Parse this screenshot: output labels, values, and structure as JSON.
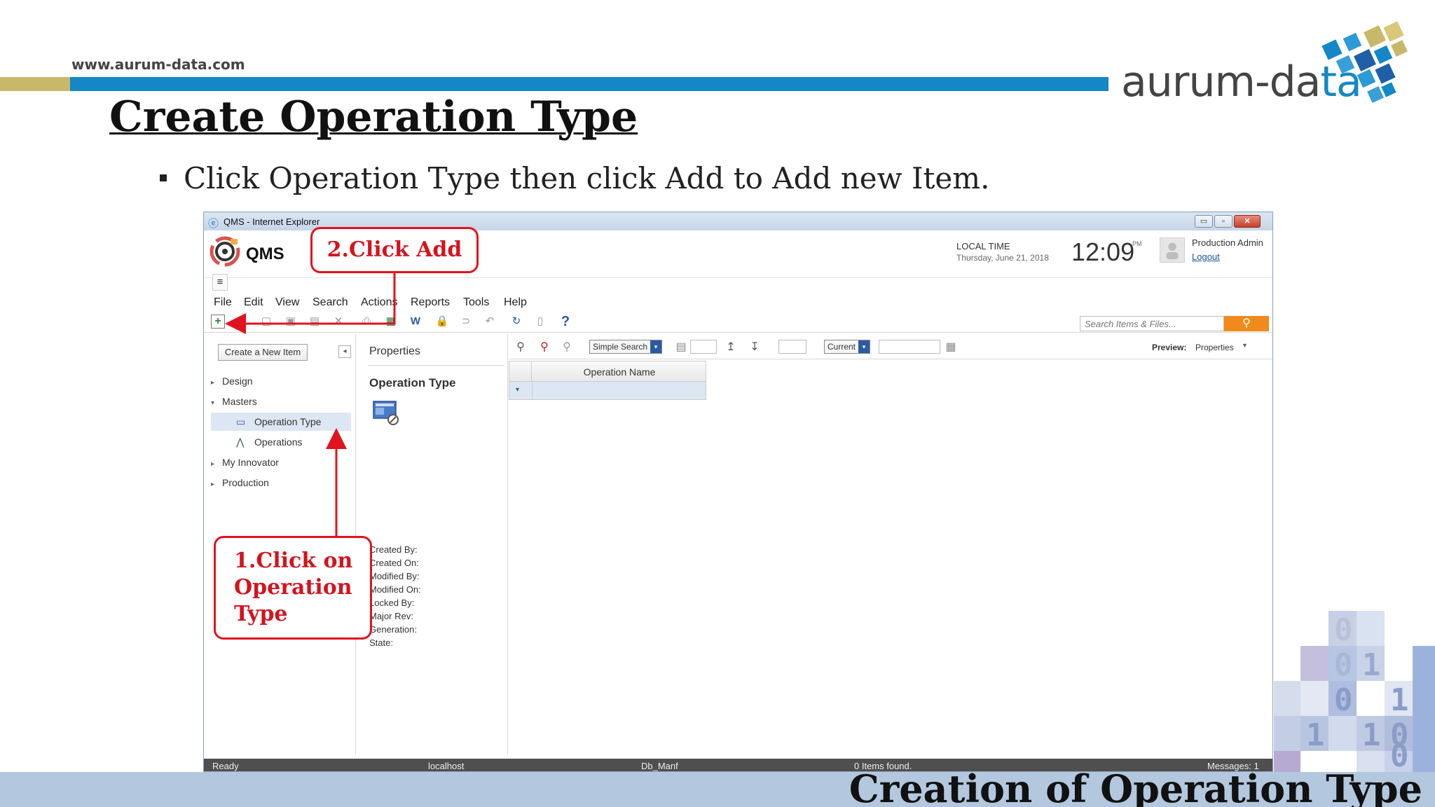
{
  "slide": {
    "site_url": "www.aurum-data.com",
    "logo": {
      "text_main": "aurum-da",
      "text_accent": "ta"
    },
    "title": "Create Operation Type",
    "bullet": "Click Operation Type  then click Add to Add new Item.",
    "footer_title": "Creation of Operation Type",
    "colors": {
      "brand_blue": "#1487c7",
      "brand_gold": "#c8b86a",
      "annotation_red": "#e0141e",
      "footer_band": "#b3c8de"
    }
  },
  "window": {
    "title": "QMS - Internet Explorer",
    "controls": {
      "minimize": "▭",
      "maximize": "▫",
      "close": "✕"
    }
  },
  "app": {
    "name": "QMS",
    "local_time_label": "LOCAL TIME",
    "local_date": "Thursday, June 21, 2018",
    "clock": "12:09",
    "clock_ampm": "PM",
    "user_name": "Production Admin",
    "logout": "Logout",
    "hamburger": "≡"
  },
  "menu": [
    "File",
    "Edit",
    "View",
    "Search",
    "Actions",
    "Reports",
    "Tools",
    "Help"
  ],
  "toolbar": {
    "icons": [
      "add-icon",
      "edit-icon",
      "view-icon",
      "save-icon",
      "save-as-icon",
      "delete-icon",
      "print-icon",
      "excel-icon",
      "word-icon",
      "lock-icon",
      "unlock-icon",
      "undo-icon",
      "refresh-icon",
      "discard-icon",
      "help-icon"
    ],
    "help_glyph": "?",
    "search_placeholder": "Search Items & Files...",
    "search_button_glyph": "⚲"
  },
  "nav": {
    "create_button": "Create a New Item",
    "collapse_glyph": "◂",
    "items": [
      {
        "label": "Design",
        "caret": "▸"
      },
      {
        "label": "Masters",
        "caret": "▾"
      },
      {
        "label": "Operation Type",
        "icon": "operation-type-icon",
        "selected": true
      },
      {
        "label": "Operations",
        "icon": "operations-icon"
      },
      {
        "label": "My Innovator",
        "caret": "▸"
      },
      {
        "label": "Production",
        "caret": "▸"
      }
    ]
  },
  "properties": {
    "header": "Properties",
    "type_name": "Operation Type",
    "fields": [
      "Created By:",
      "Created On:",
      "Modified By:",
      "Modified On:",
      "Locked By:",
      "Major Rev:",
      "Generation:",
      "State:"
    ]
  },
  "grid": {
    "simple_search": "Simple Search",
    "current": "Current",
    "preview_label": "Preview:",
    "preview_value": "Properties",
    "columns": [
      "Operation Name"
    ],
    "rows": []
  },
  "status": {
    "ready": "Ready",
    "server": "localhost",
    "database": "Db_Manf",
    "items_found": "0 Items found.",
    "messages": "Messages:  1"
  },
  "annotations": {
    "add": "2.Click Add",
    "operation_lines": [
      "1.Click on",
      "Operation",
      "Type"
    ]
  },
  "decor": {
    "binary_digits": [
      "0",
      "0",
      "1",
      "0",
      "1",
      "0",
      "1",
      "1",
      "0"
    ]
  }
}
